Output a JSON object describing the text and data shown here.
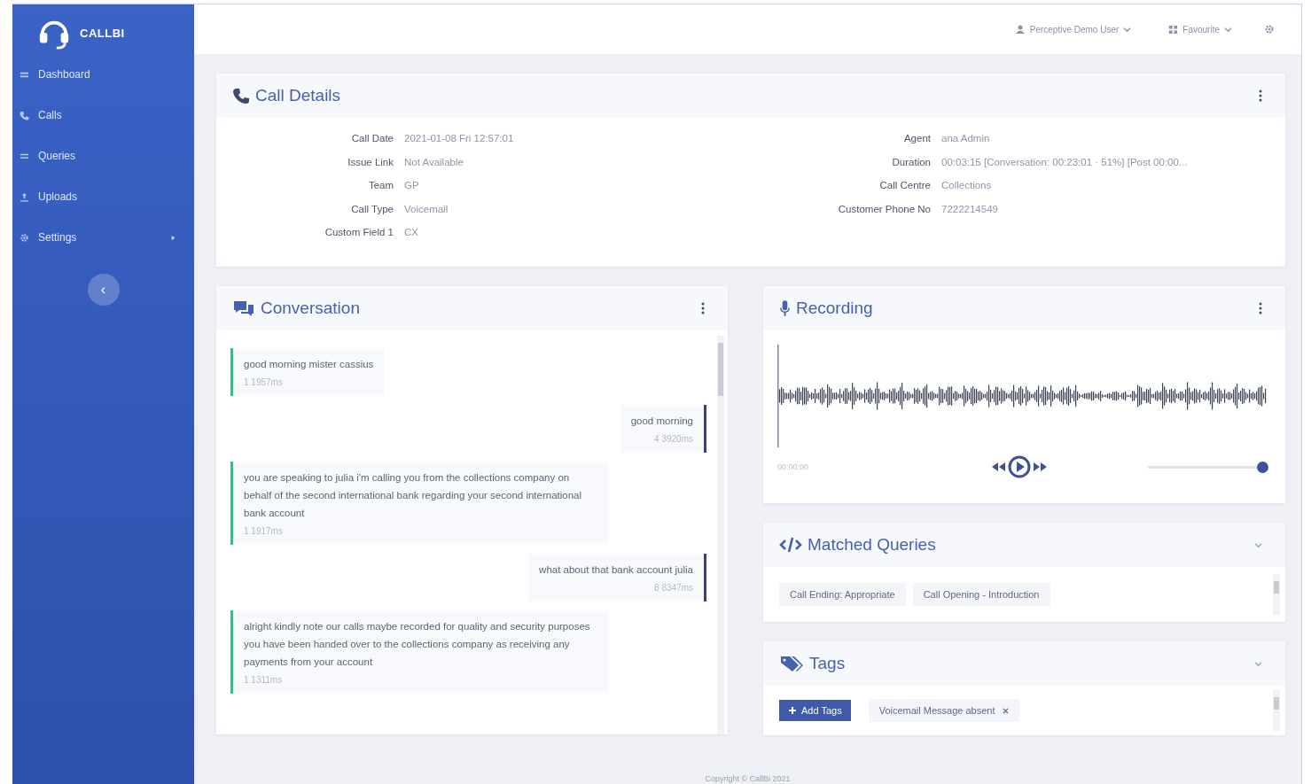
{
  "sidebar": {
    "brand": "CALLBI",
    "items": [
      {
        "label": "Dashboard",
        "kind": "link"
      },
      {
        "label": "Calls",
        "kind": "link"
      },
      {
        "label": "Queries",
        "kind": "link"
      },
      {
        "label": "Uploads",
        "kind": "link"
      },
      {
        "label": "Settings",
        "kind": "submenu"
      }
    ],
    "collapse_button": "‹"
  },
  "topbar": {
    "user_menu": "Perceptive Demo User",
    "client_menu": "Favourite"
  },
  "call_details": {
    "title": "Call Details",
    "left": [
      {
        "label": "Call Date",
        "value": "2021-01-08 Fri 12:57:01"
      },
      {
        "label": "Issue Link",
        "value": "Not Available"
      },
      {
        "label": "Team",
        "value": "GP"
      },
      {
        "label": "Call Type",
        "value": "Voicemail"
      },
      {
        "label": "Custom Field 1",
        "value": "CX"
      }
    ],
    "right": [
      {
        "label": "Agent",
        "value": "ana Admin"
      },
      {
        "label": "Duration",
        "value": "00:03:15 [Conversation: 00:23:01 · 51%] [Post 00:00..."
      },
      {
        "label": "Call Centre",
        "value": "Collections"
      },
      {
        "label": "Customer Phone No",
        "value": "7222214549"
      }
    ]
  },
  "conversation": {
    "title": "Conversation",
    "messages": [
      {
        "kind": "agent",
        "text": "good morning mister cassius",
        "time": "1 1957ms"
      },
      {
        "kind": "customer",
        "text": "good morning",
        "time": "4 3920ms"
      },
      {
        "kind": "agent",
        "text": "you are speaking to julia i'm calling you from the collections company on behalf of the second international bank regarding your second international bank account",
        "time": "1 1917ms"
      },
      {
        "kind": "customer",
        "text": "what about that bank account julia",
        "time": "8 8347ms"
      },
      {
        "kind": "agent",
        "text": "alright kindly note our calls maybe recorded for quality and security purposes you have been handed over to the collections company as receiving any payments from your account",
        "time": "1 1311ms"
      }
    ]
  },
  "recording": {
    "title": "Recording",
    "time": "00:00:00",
    "volume": {
      "level": 1
    }
  },
  "matched_queries": {
    "title": "Matched Queries",
    "items": [
      "Call Ending: Appropriate",
      "Call Opening - Introduction"
    ]
  },
  "tags": {
    "title": "Tags",
    "add_button": "Add Tags",
    "items": [
      "Voicemail Message absent"
    ]
  },
  "footer": "Copyright © CallBi 2021"
}
